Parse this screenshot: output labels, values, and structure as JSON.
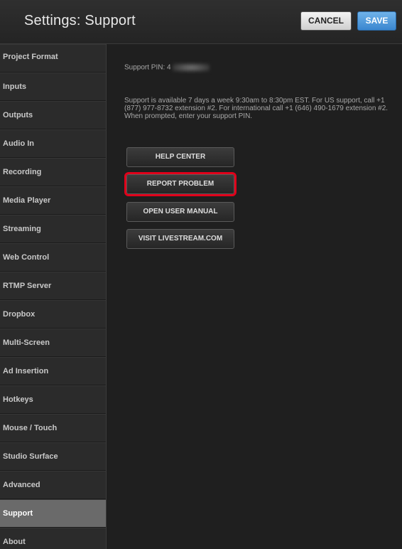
{
  "window": {
    "title": "Settings: Support"
  },
  "toolbar": {
    "cancel_label": "CANCEL",
    "save_label": "SAVE"
  },
  "sidebar": {
    "items": [
      {
        "label": "Project Format"
      },
      {
        "label": "Inputs"
      },
      {
        "label": "Outputs"
      },
      {
        "label": "Audio In"
      },
      {
        "label": "Recording"
      },
      {
        "label": "Media Player"
      },
      {
        "label": "Streaming"
      },
      {
        "label": "Web Control"
      },
      {
        "label": "RTMP Server"
      },
      {
        "label": "Dropbox"
      },
      {
        "label": "Multi-Screen"
      },
      {
        "label": "Ad Insertion"
      },
      {
        "label": "Hotkeys"
      },
      {
        "label": "Mouse / Touch"
      },
      {
        "label": "Studio Surface"
      },
      {
        "label": "Advanced"
      },
      {
        "label": "Support"
      },
      {
        "label": "About"
      }
    ],
    "active": "Support"
  },
  "support": {
    "pin_label": "Support PIN: 4",
    "info_text": "Support is available 7 days a week 9:30am to 8:30pm EST. For US support, call +1 (877) 977-8732 extension #2. For international call +1 (646) 490-1679 extension #2. When prompted, enter your support PIN.",
    "buttons": {
      "help_center": "HELP CENTER",
      "report_problem": "REPORT PROBLEM",
      "open_user_manual": "OPEN USER MANUAL",
      "visit_livestream": "VISIT LIVESTREAM.COM"
    }
  },
  "colors": {
    "accent_save": "#3a86cf",
    "highlight_outline": "#e0001a",
    "active_sidebar": "#6a6a6a"
  }
}
